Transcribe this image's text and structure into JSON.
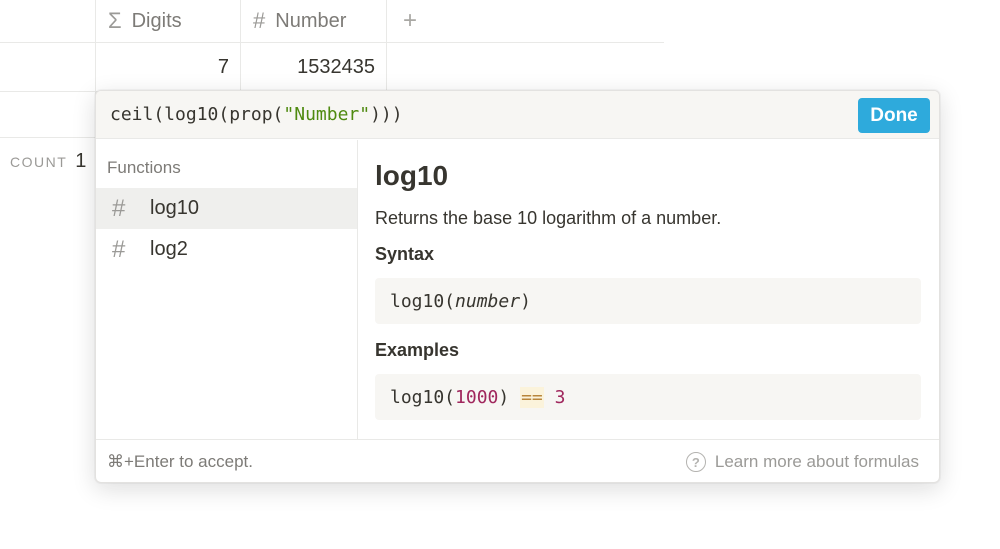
{
  "table": {
    "columns": [
      {
        "icon": "sigma-icon",
        "glyph": "Σ",
        "label": "Digits"
      },
      {
        "icon": "hash-icon",
        "glyph": "#",
        "label": "Number"
      }
    ],
    "add_glyph": "+",
    "row": {
      "digits": "7",
      "number": "1532435"
    },
    "count": {
      "label": "COUNT",
      "value": "1"
    }
  },
  "formula": {
    "before_string": "ceil(log10(prop(",
    "string": "\"Number\"",
    "after_string": ")))",
    "done_label": "Done"
  },
  "functions": {
    "heading": "Functions",
    "items": [
      {
        "glyph": "#",
        "label": "log10",
        "selected": true
      },
      {
        "glyph": "#",
        "label": "log2",
        "selected": false
      }
    ]
  },
  "detail": {
    "title": "log10",
    "description": "Returns the base 10 logarithm of a number.",
    "syntax_heading": "Syntax",
    "syntax_fn": "log10(",
    "syntax_arg": "number",
    "syntax_close": ")",
    "examples_heading": "Examples",
    "example_fn": "log10(",
    "example_num": "1000",
    "example_close": ") ",
    "example_op": "==",
    "example_result": "3"
  },
  "footer": {
    "shortcut": "⌘+Enter",
    "hint": " to accept.",
    "help_glyph": "?",
    "learn_more": "Learn more about formulas"
  },
  "colors": {
    "accent": "#2eaadc",
    "string": "#4f8a10",
    "number": "#a0275d",
    "operator": "#b8863b"
  }
}
